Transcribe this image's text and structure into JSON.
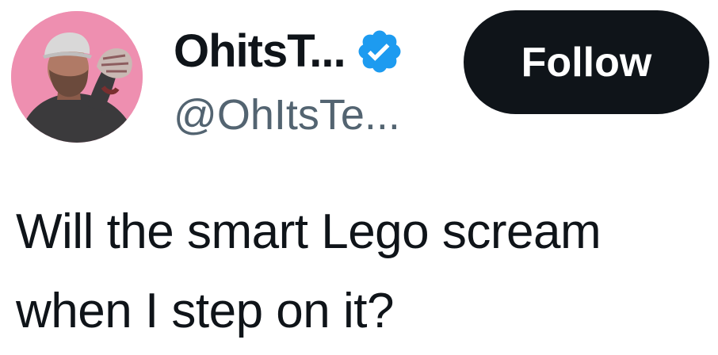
{
  "author": {
    "display_name": "OhitsT...",
    "handle": "@OhItsTe...",
    "verified": true,
    "avatar_icon": "profile-photo",
    "verified_icon": "verified-badge-icon"
  },
  "follow_button": {
    "label": "Follow"
  },
  "tweet": {
    "lines": [
      "Will the smart Lego scream",
      "when I step on it?"
    ]
  },
  "colors": {
    "text_primary": "#0f1419",
    "text_secondary": "#536471",
    "verified_blue": "#1d9bf0",
    "avatar_background": "#ee8fb0",
    "button_background": "#0f1419",
    "button_text": "#ffffff"
  }
}
